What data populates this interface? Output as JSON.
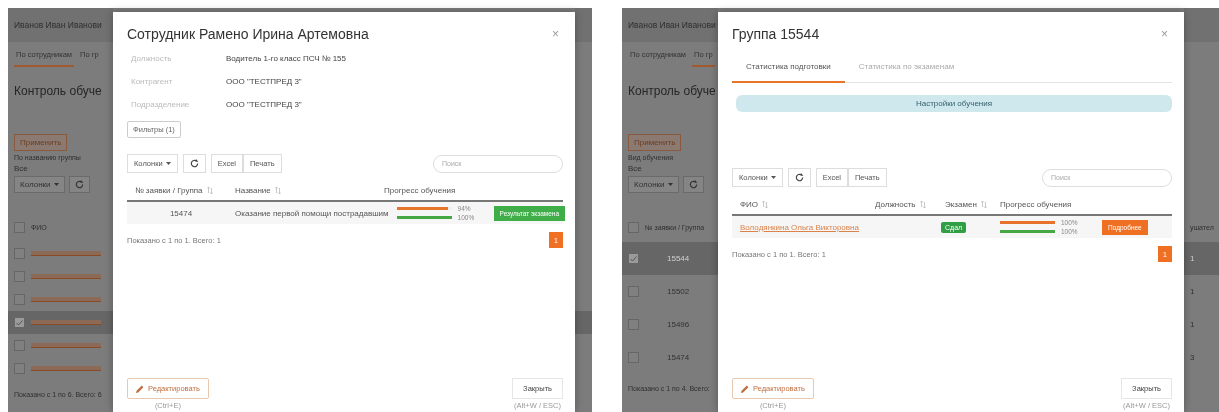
{
  "screens": [
    {
      "kind": "employee",
      "background": {
        "user": "Иванов Иван Иванови",
        "tabs": [
          {
            "label": "По сотрудникам",
            "selected": true
          },
          {
            "label": "По гр",
            "selected": false
          }
        ],
        "heading": "Контроль обуче",
        "filter_buttons": [
          "Применить"
        ],
        "filter_label": "По названию группы",
        "filter_value": "Все",
        "columns_button": "Колонки",
        "table": {
          "column": "ФИО",
          "header_checked": false,
          "rows": [
            {
              "checked": false,
              "selected": false,
              "cell": {
                "kind": "obscured-link"
              }
            },
            {
              "checked": false,
              "selected": false,
              "cell": {
                "kind": "obscured-link"
              }
            },
            {
              "checked": false,
              "selected": false,
              "cell": {
                "kind": "obscured-link"
              }
            },
            {
              "checked": true,
              "selected": true,
              "cell": {
                "kind": "obscured-link"
              }
            },
            {
              "checked": false,
              "selected": false,
              "cell": {
                "kind": "obscured-link"
              }
            },
            {
              "checked": false,
              "selected": false,
              "cell": {
                "kind": "obscured-link"
              }
            }
          ]
        },
        "footer": "Показано с 1 по 6. Всего: 6"
      },
      "modal": {
        "title": "Сотрудник Рамено Ирина Артемовна",
        "close": "×",
        "fields": [
          {
            "label": "Должность",
            "value": "Водитель 1-го класс ПСЧ № 155"
          },
          {
            "label": "Контрагент",
            "value": "ООО \"ТЕСТПРЕД 3\""
          },
          {
            "label": "Подразделение",
            "value": "ООО \"ТЕСТПРЕД 3\""
          }
        ],
        "filters_button": "Фильтры (1)",
        "toolbar": {
          "columns": "Колонки",
          "buttons": [
            "Excel",
            "Печать"
          ],
          "search_placeholder": "Поиск"
        },
        "table": {
          "columns": [
            {
              "label": "№ заявки / Группа",
              "sortable": true
            },
            {
              "label": "Название",
              "sortable": true
            },
            {
              "label": "Прогресс обучения",
              "sortable": false
            }
          ],
          "rows": [
            {
              "cells": [
                {
                  "kind": "number",
                  "text": "15474"
                },
                {
                  "kind": "text",
                  "text": "Оказание первой помощи пострадавшим"
                },
                {
                  "kind": "progress",
                  "bars": [
                    {
                      "level": 0.94,
                      "reading": "94%",
                      "color": "#e8732a"
                    },
                    {
                      "level": 1,
                      "reading": "100%",
                      "color": "#45a845"
                    }
                  ]
                },
                {
                  "kind": "action",
                  "text": "Результат экзамена",
                  "color": "#3fae49"
                }
              ]
            }
          ]
        },
        "table_footer": "Показано с 1 по 1. Всего: 1",
        "page": "1",
        "edit_button": "Редактировать",
        "edit_hint": "(Ctrl+E)",
        "close_button": "Закрыть",
        "close_hint": "(Alt+W / ESC)"
      }
    },
    {
      "kind": "group",
      "background": {
        "user": "Иванов Иван Иванови",
        "tabs": [
          {
            "label": "По сотрудникам",
            "selected": false
          },
          {
            "label": "По гр",
            "selected": true
          }
        ],
        "heading": "Контроль обуче",
        "filter_buttons": [
          "Применить"
        ],
        "filter_label": "Вид обучения",
        "filter_value": "Все",
        "columns_button": "Колонки",
        "table": {
          "column": "№ заявки / Группа",
          "header_checked": false,
          "side_column": "ушател",
          "rows": [
            {
              "checked": true,
              "selected": true,
              "cell": {
                "kind": "number",
                "text": "15544"
              },
              "side": "1"
            },
            {
              "checked": false,
              "selected": false,
              "cell": {
                "kind": "number",
                "text": "15502"
              },
              "side": "1"
            },
            {
              "checked": false,
              "selected": false,
              "cell": {
                "kind": "number",
                "text": "15496"
              },
              "side": "1"
            },
            {
              "checked": false,
              "selected": false,
              "cell": {
                "kind": "number",
                "text": "15474"
              },
              "side": "3"
            }
          ]
        },
        "footer": "Показано с 1 по 4. Всего:"
      },
      "modal": {
        "title": "Группа 15544",
        "close": "×",
        "tabs": [
          {
            "label": "Статистика подготовки",
            "selected": true
          },
          {
            "label": "Статистика по экзаменам",
            "selected": false
          }
        ],
        "info": "Настройки обучения",
        "toolbar": {
          "columns": "Колонки",
          "buttons": [
            "Excel",
            "Печать"
          ],
          "search_placeholder": "Поиск"
        },
        "table": {
          "columns": [
            {
              "label": "ФИО",
              "sortable": true
            },
            {
              "label": "Должность",
              "sortable": true
            },
            {
              "label": "Экзамен",
              "sortable": true
            },
            {
              "label": "Прогресс обучения",
              "sortable": false
            }
          ],
          "rows": [
            {
              "cells": [
                {
                  "kind": "link",
                  "text": "Володянкина Ольга Викторовна"
                },
                {
                  "kind": "blank"
                },
                {
                  "kind": "badge",
                  "text": "Сдал",
                  "color": "#2f9e44"
                },
                {
                  "kind": "progress",
                  "bars": [
                    {
                      "level": 1,
                      "reading": "100%",
                      "color": "#e8732a"
                    },
                    {
                      "level": 1,
                      "reading": "100%",
                      "color": "#45a845"
                    }
                  ]
                },
                {
                  "kind": "action",
                  "text": "Подробнее",
                  "color": "#f07023"
                }
              ]
            }
          ]
        },
        "table_footer": "Показано с 1 по 1. Всего: 1",
        "page": "1",
        "edit_button": "Редактировать",
        "edit_hint": "(Ctrl+E)",
        "close_button": "Закрыть",
        "close_hint": "(Alt+W / ESC)"
      }
    }
  ]
}
